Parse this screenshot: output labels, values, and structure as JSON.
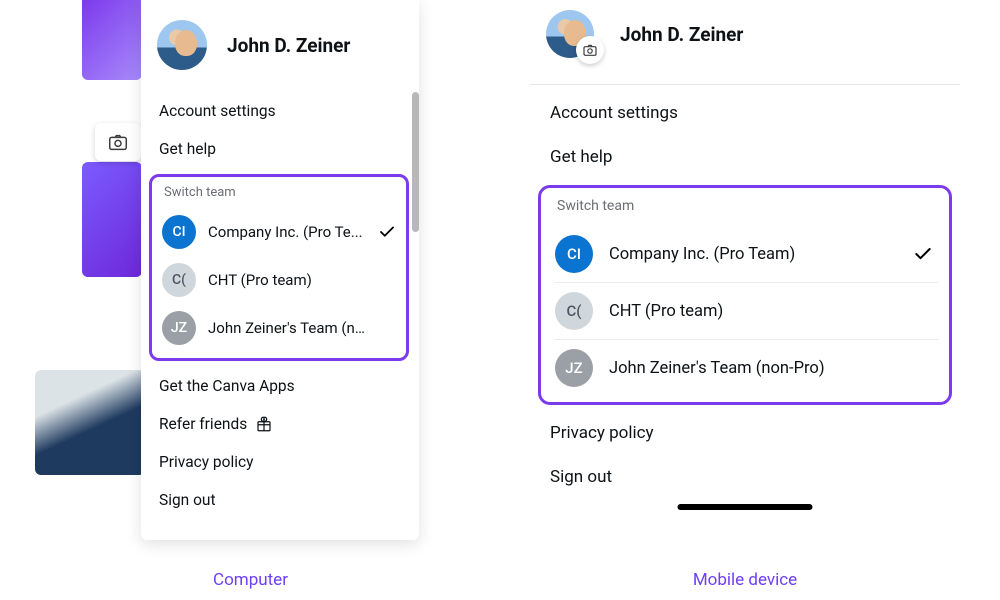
{
  "user": {
    "name": "John D. Zeiner"
  },
  "computer": {
    "account_settings": "Account settings",
    "get_help": "Get help",
    "switch_team": "Switch team",
    "teams": [
      {
        "initials": "CI",
        "name": "Company Inc. (Pro Te...",
        "selected": true,
        "badge": "badge-blue"
      },
      {
        "initials": "C(",
        "name": "CHT (Pro team)",
        "selected": false,
        "badge": "badge-light"
      },
      {
        "initials": "JZ",
        "name": "John Zeiner's Team (n...",
        "selected": false,
        "badge": "badge-grey"
      }
    ],
    "get_apps": "Get the Canva Apps",
    "refer": "Refer friends",
    "privacy": "Privacy policy",
    "sign_out": "Sign out",
    "caption": "Computer"
  },
  "mobile": {
    "account_settings": "Account settings",
    "get_help": "Get help",
    "switch_team": "Switch team",
    "teams": [
      {
        "initials": "CI",
        "name": "Company Inc. (Pro Team)",
        "selected": true,
        "badge": "badge-blue"
      },
      {
        "initials": "C(",
        "name": "CHT (Pro team)",
        "selected": false,
        "badge": "badge-light"
      },
      {
        "initials": "JZ",
        "name": "John Zeiner's Team (non-Pro)",
        "selected": false,
        "badge": "badge-grey"
      }
    ],
    "privacy": "Privacy policy",
    "sign_out": "Sign out",
    "caption": "Mobile device"
  }
}
